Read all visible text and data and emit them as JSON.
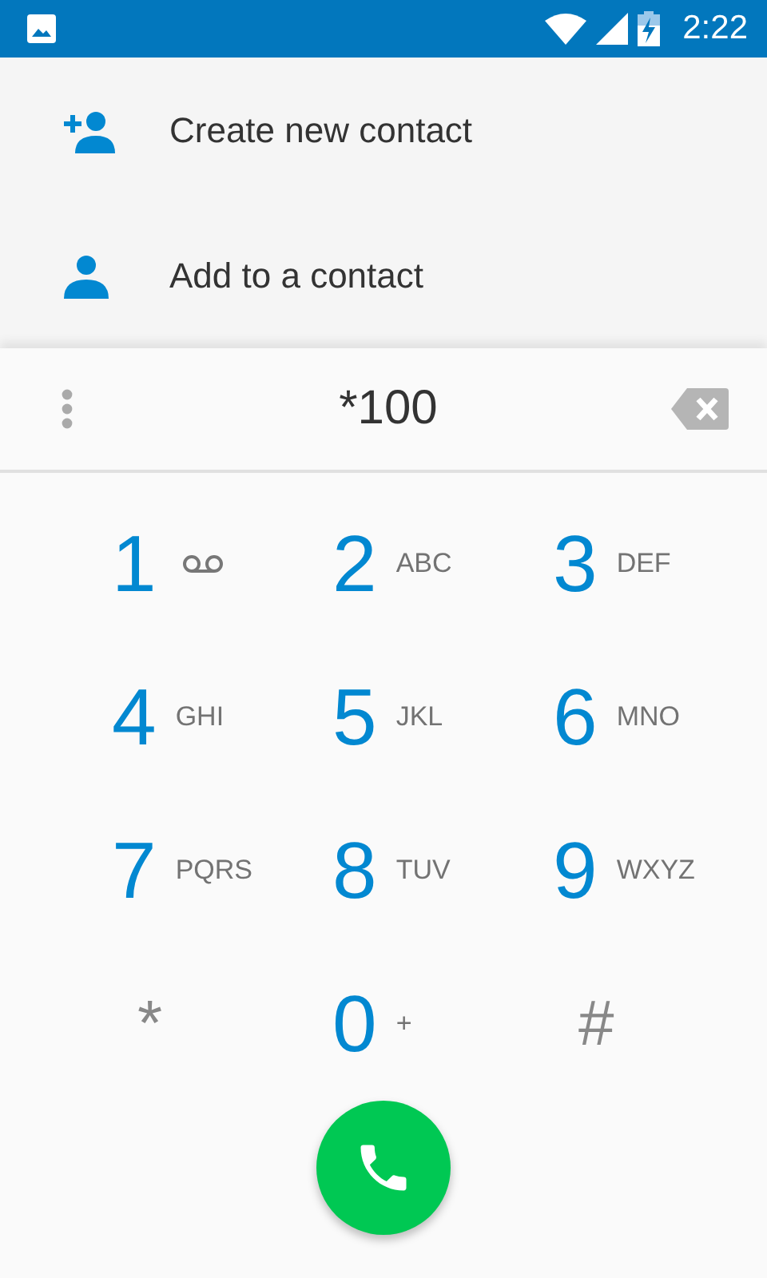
{
  "status_bar": {
    "time": "2:22"
  },
  "actions": [
    {
      "kind": "create",
      "label": "Create new contact"
    },
    {
      "kind": "add",
      "label": "Add to a contact"
    }
  ],
  "dial_field": {
    "value": "*100"
  },
  "keys": [
    {
      "kind": "voicemail",
      "label": "1"
    },
    {
      "kind": "letters",
      "label": "2",
      "letters": "ABC"
    },
    {
      "kind": "letters",
      "label": "3",
      "letters": "DEF"
    },
    {
      "kind": "letters",
      "label": "4",
      "letters": "GHI"
    },
    {
      "kind": "letters",
      "label": "5",
      "letters": "JKL"
    },
    {
      "kind": "letters",
      "label": "6",
      "letters": "MNO"
    },
    {
      "kind": "letters",
      "label": "7",
      "letters": "PQRS"
    },
    {
      "kind": "letters",
      "label": "8",
      "letters": "TUV"
    },
    {
      "kind": "letters",
      "label": "9",
      "letters": "WXYZ"
    },
    {
      "kind": "symbol",
      "label": "*"
    },
    {
      "kind": "letters",
      "label": "0",
      "letters": "+"
    },
    {
      "kind": "symbol",
      "label": "#"
    }
  ]
}
